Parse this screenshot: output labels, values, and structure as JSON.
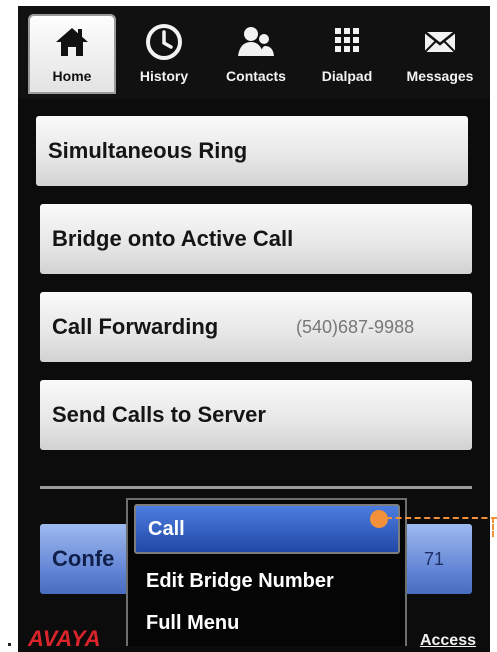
{
  "nav": {
    "tabs": [
      {
        "label": "Home",
        "icon": "home-icon",
        "active": true
      },
      {
        "label": "History",
        "icon": "clock-icon",
        "active": false
      },
      {
        "label": "Contacts",
        "icon": "contacts-icon",
        "active": false
      },
      {
        "label": "Dialpad",
        "icon": "dialpad-icon",
        "active": false
      },
      {
        "label": "Messages",
        "icon": "envelope-icon",
        "active": false
      }
    ]
  },
  "menu": {
    "simultaneous_ring": "Simultaneous Ring",
    "bridge": "Bridge onto Active Call",
    "call_forwarding": "Call Forwarding",
    "call_forwarding_number": "(540)687-9988",
    "send_to_server": "Send Calls to Server",
    "conference_label": "Confe",
    "conference_tail": "71"
  },
  "popup": {
    "items": [
      "Call",
      "Edit Bridge Number",
      "Full Menu"
    ]
  },
  "footer": {
    "logo": "AVAYA",
    "access": "Access"
  },
  "colors": {
    "accent_blue": "#2148a6",
    "callout_orange": "#f2913a",
    "brand_red": "#d8242a"
  }
}
